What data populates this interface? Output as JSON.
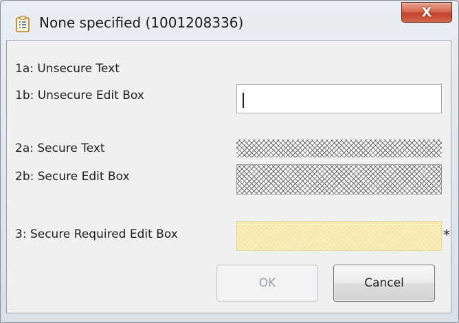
{
  "window": {
    "title": "None specified (1001208336)",
    "icon": "clipboard-document-icon",
    "close_label": "X"
  },
  "fields": {
    "unsecure_text_label": "1a: Unsecure Text",
    "unsecure_edit_label": "1b: Unsecure Edit Box",
    "unsecure_edit_value": "",
    "secure_text_label": "2a: Secure Text",
    "secure_edit_label": "2b: Secure Edit Box",
    "secure_required_label": "3: Secure Required Edit Box",
    "required_marker": "*"
  },
  "buttons": {
    "ok_label": "OK",
    "cancel_label": "Cancel"
  },
  "colors": {
    "required_fill": "#f5e9a8",
    "close_button": "#c2412a"
  }
}
